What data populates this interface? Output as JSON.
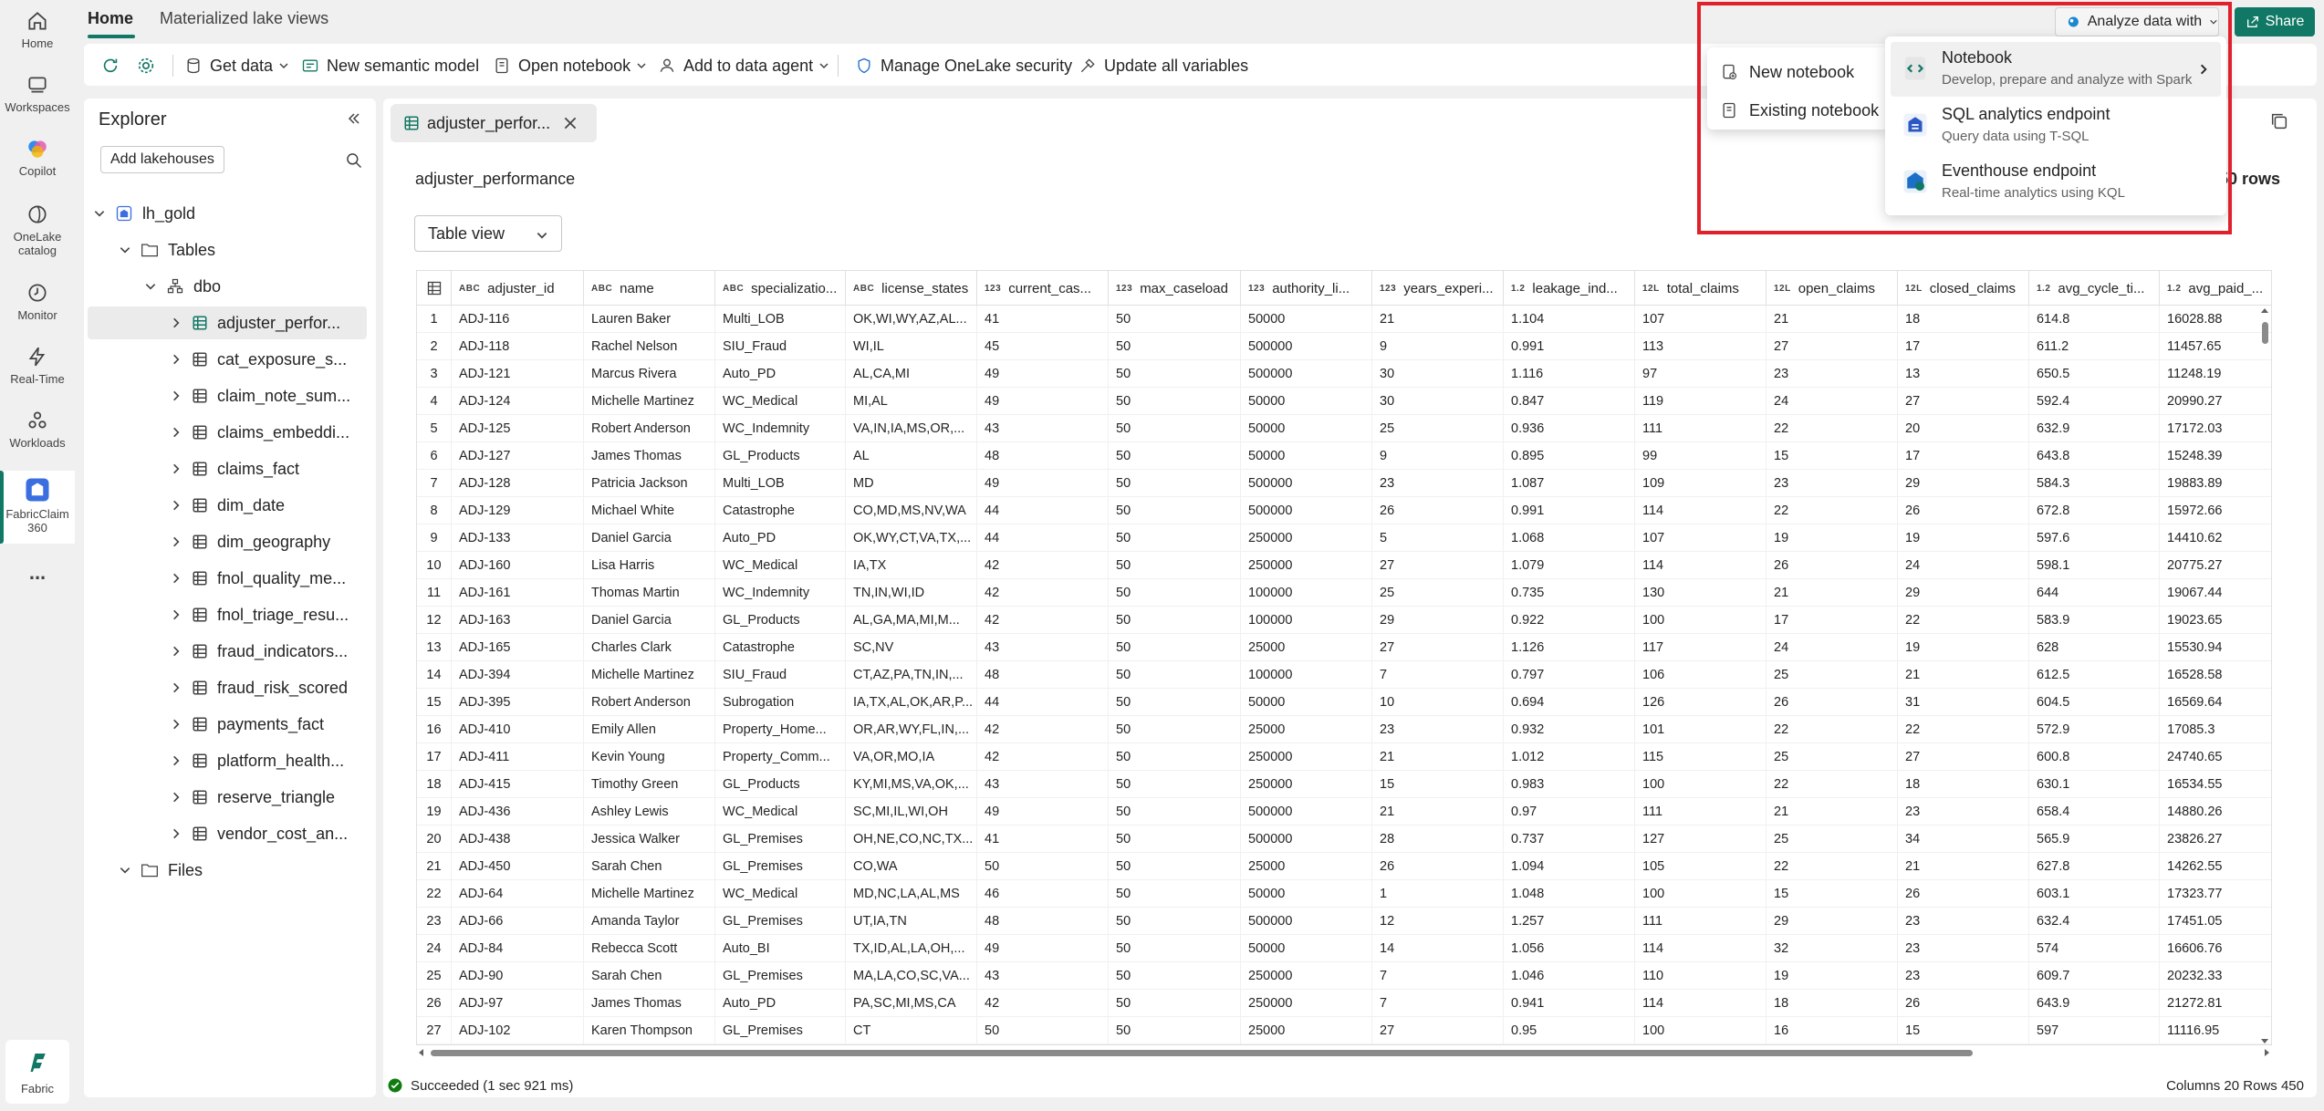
{
  "nav": {
    "items": [
      {
        "label": "Home",
        "icon": "home-icon"
      },
      {
        "label": "Workspaces",
        "icon": "workspaces-icon"
      },
      {
        "label": "Copilot",
        "icon": "copilot-icon"
      },
      {
        "label": "OneLake catalog",
        "icon": "onelake-icon"
      },
      {
        "label": "Monitor",
        "icon": "monitor-icon"
      },
      {
        "label": "Real-Time",
        "icon": "realtime-icon"
      },
      {
        "label": "Workloads",
        "icon": "workloads-icon"
      },
      {
        "label": "FabricClaim 360",
        "icon": "lakehouse-app-icon"
      }
    ],
    "more": "...",
    "fabric_label": "Fabric"
  },
  "top_tabs": {
    "home": "Home",
    "mlv": "Materialized lake views"
  },
  "ribbon": {
    "get_data": "Get data",
    "new_semantic_model": "New semantic model",
    "open_notebook": "Open notebook",
    "add_to_data_agent": "Add to data agent",
    "manage_security": "Manage OneLake security",
    "update_variables": "Update all variables"
  },
  "actions": {
    "analyze": "Analyze data with",
    "share": "Share"
  },
  "explorer": {
    "title": "Explorer",
    "add_lakehouses": "Add lakehouses",
    "lakehouse": "lh_gold",
    "tables_folder": "Tables",
    "schema": "dbo",
    "tables": [
      "adjuster_perfor...",
      "cat_exposure_s...",
      "claim_note_sum...",
      "claims_embeddi...",
      "claims_fact",
      "dim_date",
      "dim_geography",
      "fnol_quality_me...",
      "fnol_triage_resu...",
      "fraud_indicators...",
      "fraud_risk_scored",
      "payments_fact",
      "platform_health...",
      "reserve_triangle",
      "vendor_cost_an..."
    ],
    "files_folder": "Files"
  },
  "doc_tab": {
    "label": "adjuster_perfor..."
  },
  "table": {
    "title": "adjuster_performance",
    "row_count": "450 rows",
    "view": "Table view",
    "columns": [
      {
        "type": "ABC",
        "name": "adjuster_id"
      },
      {
        "type": "ABC",
        "name": "name"
      },
      {
        "type": "ABC",
        "name": "specializatio..."
      },
      {
        "type": "ABC",
        "name": "license_states"
      },
      {
        "type": "123",
        "name": "current_cas..."
      },
      {
        "type": "123",
        "name": "max_caseload"
      },
      {
        "type": "123",
        "name": "authority_li..."
      },
      {
        "type": "123",
        "name": "years_experi..."
      },
      {
        "type": "1.2",
        "name": "leakage_ind..."
      },
      {
        "type": "12L",
        "name": "total_claims"
      },
      {
        "type": "12L",
        "name": "open_claims"
      },
      {
        "type": "12L",
        "name": "closed_claims"
      },
      {
        "type": "1.2",
        "name": "avg_cycle_ti..."
      },
      {
        "type": "1.2",
        "name": "avg_paid_..."
      }
    ],
    "rows": [
      [
        "1",
        "ADJ-116",
        "Lauren Baker",
        "Multi_LOB",
        "OK,WI,WY,AZ,AL...",
        "41",
        "50",
        "50000",
        "21",
        "1.104",
        "107",
        "21",
        "18",
        "614.8",
        "16028.88"
      ],
      [
        "2",
        "ADJ-118",
        "Rachel Nelson",
        "SIU_Fraud",
        "WI,IL",
        "45",
        "50",
        "500000",
        "9",
        "0.991",
        "113",
        "27",
        "17",
        "611.2",
        "11457.65"
      ],
      [
        "3",
        "ADJ-121",
        "Marcus Rivera",
        "Auto_PD",
        "AL,CA,MI",
        "49",
        "50",
        "500000",
        "30",
        "1.116",
        "97",
        "23",
        "13",
        "650.5",
        "11248.19"
      ],
      [
        "4",
        "ADJ-124",
        "Michelle Martinez",
        "WC_Medical",
        "MI,AL",
        "49",
        "50",
        "50000",
        "30",
        "0.847",
        "119",
        "24",
        "27",
        "592.4",
        "20990.27"
      ],
      [
        "5",
        "ADJ-125",
        "Robert Anderson",
        "WC_Indemnity",
        "VA,IN,IA,MS,OR,...",
        "43",
        "50",
        "50000",
        "25",
        "0.936",
        "111",
        "22",
        "20",
        "632.9",
        "17172.03"
      ],
      [
        "6",
        "ADJ-127",
        "James Thomas",
        "GL_Products",
        "AL",
        "48",
        "50",
        "50000",
        "9",
        "0.895",
        "99",
        "15",
        "17",
        "643.8",
        "15248.39"
      ],
      [
        "7",
        "ADJ-128",
        "Patricia Jackson",
        "Multi_LOB",
        "MD",
        "49",
        "50",
        "500000",
        "23",
        "1.087",
        "109",
        "23",
        "29",
        "584.3",
        "19883.89"
      ],
      [
        "8",
        "ADJ-129",
        "Michael White",
        "Catastrophe",
        "CO,MD,MS,NV,WA",
        "44",
        "50",
        "500000",
        "26",
        "0.991",
        "114",
        "22",
        "26",
        "672.8",
        "15972.66"
      ],
      [
        "9",
        "ADJ-133",
        "Daniel Garcia",
        "Auto_PD",
        "OK,WY,CT,VA,TX,...",
        "44",
        "50",
        "250000",
        "5",
        "1.068",
        "107",
        "19",
        "19",
        "597.6",
        "14410.62"
      ],
      [
        "10",
        "ADJ-160",
        "Lisa Harris",
        "WC_Medical",
        "IA,TX",
        "42",
        "50",
        "250000",
        "27",
        "1.079",
        "114",
        "26",
        "24",
        "598.1",
        "20775.27"
      ],
      [
        "11",
        "ADJ-161",
        "Thomas Martin",
        "WC_Indemnity",
        "TN,IN,WI,ID",
        "42",
        "50",
        "100000",
        "25",
        "0.735",
        "130",
        "21",
        "29",
        "644",
        "19067.44"
      ],
      [
        "12",
        "ADJ-163",
        "Daniel Garcia",
        "GL_Products",
        "AL,GA,MA,MI,M...",
        "42",
        "50",
        "100000",
        "29",
        "0.922",
        "100",
        "17",
        "22",
        "583.9",
        "19023.65"
      ],
      [
        "13",
        "ADJ-165",
        "Charles Clark",
        "Catastrophe",
        "SC,NV",
        "43",
        "50",
        "25000",
        "27",
        "1.126",
        "117",
        "24",
        "19",
        "628",
        "15530.94"
      ],
      [
        "14",
        "ADJ-394",
        "Michelle Martinez",
        "SIU_Fraud",
        "CT,AZ,PA,TN,IN,...",
        "48",
        "50",
        "100000",
        "7",
        "0.797",
        "106",
        "25",
        "21",
        "612.5",
        "16528.58"
      ],
      [
        "15",
        "ADJ-395",
        "Robert Anderson",
        "Subrogation",
        "IA,TX,AL,OK,AR,P...",
        "44",
        "50",
        "50000",
        "10",
        "0.694",
        "126",
        "26",
        "31",
        "604.5",
        "16569.64"
      ],
      [
        "16",
        "ADJ-410",
        "Emily Allen",
        "Property_Home...",
        "OR,AR,WY,FL,IN,...",
        "42",
        "50",
        "25000",
        "23",
        "0.932",
        "101",
        "22",
        "22",
        "572.9",
        "17085.3"
      ],
      [
        "17",
        "ADJ-411",
        "Kevin Young",
        "Property_Comm...",
        "VA,OR,MO,IA",
        "42",
        "50",
        "250000",
        "21",
        "1.012",
        "115",
        "25",
        "27",
        "600.8",
        "24740.65"
      ],
      [
        "18",
        "ADJ-415",
        "Timothy Green",
        "GL_Products",
        "KY,MI,MS,VA,OK,...",
        "43",
        "50",
        "250000",
        "15",
        "0.983",
        "100",
        "22",
        "18",
        "630.1",
        "16534.55"
      ],
      [
        "19",
        "ADJ-436",
        "Ashley Lewis",
        "WC_Medical",
        "SC,MI,IL,WI,OH",
        "49",
        "50",
        "500000",
        "21",
        "0.97",
        "111",
        "21",
        "23",
        "658.4",
        "14880.26"
      ],
      [
        "20",
        "ADJ-438",
        "Jessica Walker",
        "GL_Premises",
        "OH,NE,CO,NC,TX...",
        "41",
        "50",
        "500000",
        "28",
        "0.737",
        "127",
        "25",
        "34",
        "565.9",
        "23826.27"
      ],
      [
        "21",
        "ADJ-450",
        "Sarah Chen",
        "GL_Premises",
        "CO,WA",
        "50",
        "50",
        "25000",
        "26",
        "1.094",
        "105",
        "22",
        "21",
        "627.8",
        "14262.55"
      ],
      [
        "22",
        "ADJ-64",
        "Michelle Martinez",
        "WC_Medical",
        "MD,NC,LA,AL,MS",
        "46",
        "50",
        "50000",
        "1",
        "1.048",
        "100",
        "15",
        "26",
        "603.1",
        "17323.77"
      ],
      [
        "23",
        "ADJ-66",
        "Amanda Taylor",
        "GL_Premises",
        "UT,IA,TN",
        "48",
        "50",
        "500000",
        "12",
        "1.257",
        "111",
        "29",
        "23",
        "632.4",
        "17451.05"
      ],
      [
        "24",
        "ADJ-84",
        "Rebecca Scott",
        "Auto_BI",
        "TX,ID,AL,LA,OH,...",
        "49",
        "50",
        "50000",
        "14",
        "1.056",
        "114",
        "32",
        "23",
        "574",
        "16606.76"
      ],
      [
        "25",
        "ADJ-90",
        "Sarah Chen",
        "GL_Premises",
        "MA,LA,CO,SC,VA...",
        "43",
        "50",
        "250000",
        "7",
        "1.046",
        "110",
        "19",
        "23",
        "609.7",
        "20232.33"
      ],
      [
        "26",
        "ADJ-97",
        "James Thomas",
        "Auto_PD",
        "PA,SC,MI,MS,CA",
        "42",
        "50",
        "250000",
        "7",
        "0.941",
        "114",
        "18",
        "26",
        "643.9",
        "21272.81"
      ],
      [
        "27",
        "ADJ-102",
        "Karen Thompson",
        "GL_Premises",
        "CT",
        "50",
        "50",
        "25000",
        "27",
        "0.95",
        "100",
        "16",
        "15",
        "597",
        "11116.95"
      ]
    ]
  },
  "status": {
    "message": "Succeeded (1 sec 921 ms)",
    "summary": "Columns 20 Rows 450"
  },
  "menu_open_notebook": {
    "new": "New notebook",
    "existing": "Existing notebook"
  },
  "menu_analyze": [
    {
      "title": "Notebook",
      "desc": "Develop, prepare and analyze with Spark"
    },
    {
      "title": "SQL analytics endpoint",
      "desc": "Query data using T-SQL"
    },
    {
      "title": "Eventhouse endpoint",
      "desc": "Real-time analytics using KQL"
    }
  ],
  "colors": {
    "accent": "#117865",
    "highlight": "#e0202a"
  }
}
